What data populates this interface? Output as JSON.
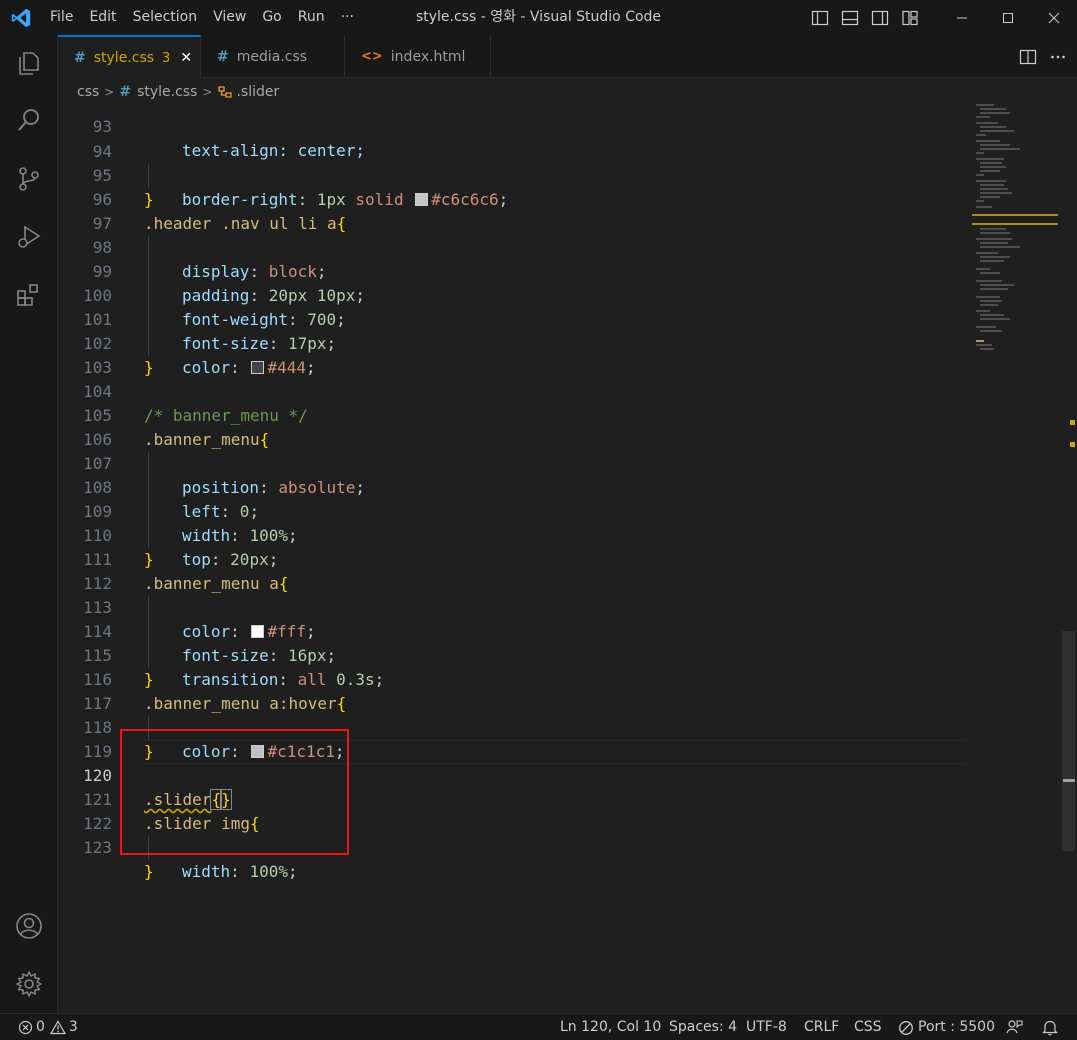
{
  "titlebar": {
    "menu": [
      "File",
      "Edit",
      "Selection",
      "View",
      "Go",
      "Run",
      "···"
    ],
    "title": "style.css - 영화 - Visual Studio Code"
  },
  "tabs": [
    {
      "icon": "#",
      "label": "style.css",
      "badge": "3",
      "close": "✕",
      "active": true
    },
    {
      "icon": "#",
      "label": "media.css",
      "active": false
    },
    {
      "icon": "<>",
      "label": "index.html",
      "active": false
    }
  ],
  "breadcrumb": {
    "folder": "css",
    "file_icon": "#",
    "file": "style.css",
    "symbol": ".slider"
  },
  "code": {
    "line_93": "93",
    "l93_text": "text-align: center;",
    "ln": [
      "94",
      "95",
      "96",
      "97",
      "98",
      "99",
      "100",
      "101",
      "102",
      "103",
      "104",
      "105",
      "106",
      "107",
      "108",
      "109",
      "110",
      "111",
      "112",
      "113",
      "114",
      "115",
      "116",
      "117",
      "118",
      "119",
      "120",
      "121",
      "122",
      "123"
    ],
    "t": {
      "prop_border_right": "border-right",
      "v_1px": "1px",
      "v_solid": "solid",
      "c_c6c6c6": "#c6c6c6",
      "sel_header_nav": ".header .nav ul li a",
      "prop_display": "display",
      "v_block": "block",
      "prop_padding": "padding",
      "v_20px": "20px",
      "v_10px": "10px",
      "prop_font_weight": "font-weight",
      "v_700": "700",
      "prop_font_size": "font-size",
      "v_17px": "17px",
      "prop_color": "color",
      "c_444": "#444",
      "comment_banner": "/* banner_menu */",
      "sel_banner_menu": ".banner_menu",
      "prop_position": "position",
      "v_absolute": "absolute",
      "prop_left": "left",
      "v_0": "0",
      "prop_width": "width",
      "v_100": "100%",
      "prop_top": "top",
      "v_20px_b": "20px",
      "sel_banner_a": ".banner_menu a",
      "c_fff": "#fff",
      "v_16px": "16px",
      "prop_transition": "transition",
      "v_all": "all",
      "v_03s": "0.3s",
      "sel_banner_hover": ".banner_menu a:hover",
      "c_c1c1c1": "#c1c1c1",
      "sel_slider": ".slider",
      "sel_slider_img": ".slider img",
      "v_100_b": "100%"
    },
    "colors": {
      "c6c6c6": "#c6c6c6",
      "444": "#444444",
      "fff": "#ffffff",
      "c1c1c1": "#c1c1c1"
    }
  },
  "statusbar": {
    "errors": "0",
    "warnings": "3",
    "position": "Ln 120, Col 10",
    "spaces": "Spaces: 4",
    "encoding": "UTF-8",
    "eol": "CRLF",
    "language": "CSS",
    "port": "Port : 5500"
  }
}
